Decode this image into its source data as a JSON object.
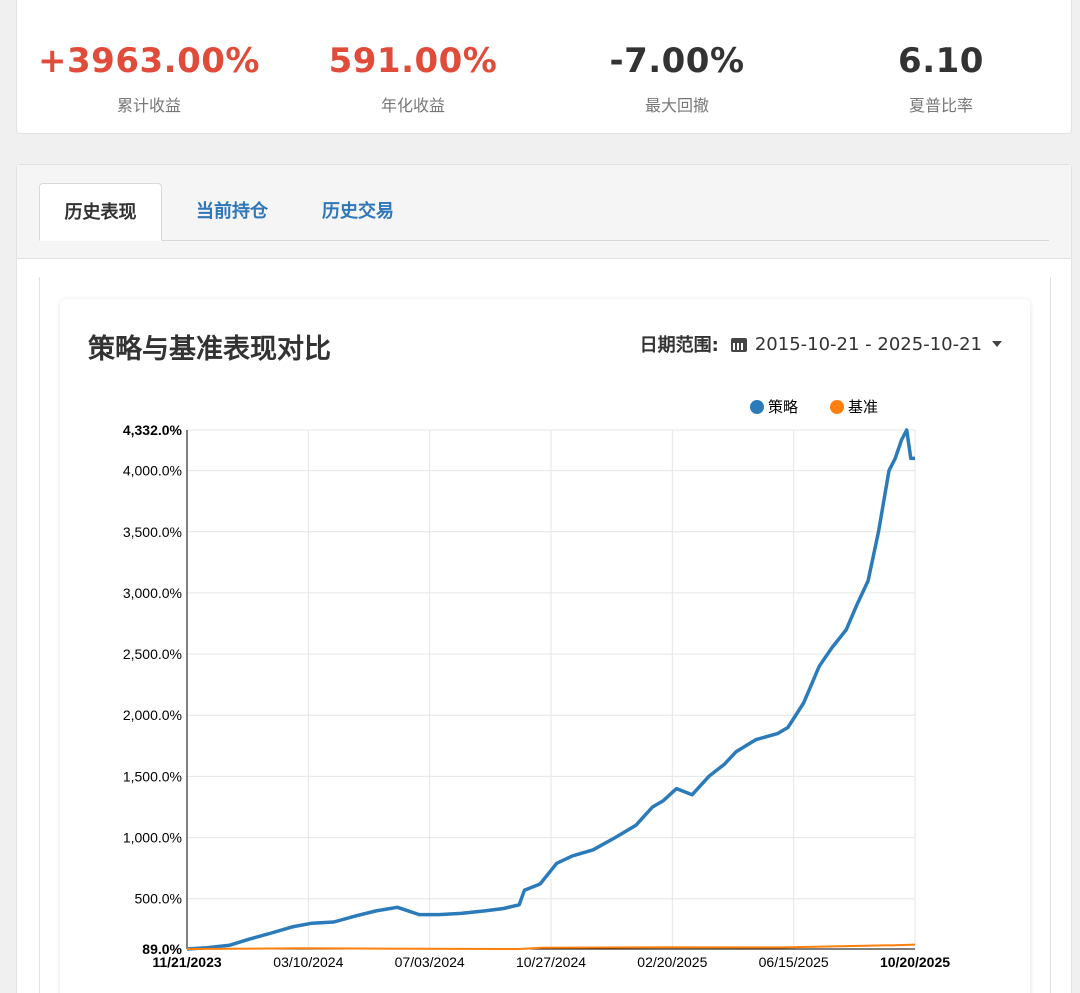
{
  "stats": [
    {
      "value": "+3963.00%",
      "label": "累计收益",
      "color": "#e04b3a"
    },
    {
      "value": "591.00%",
      "label": "年化收益",
      "color": "#e04b3a"
    },
    {
      "value": "-7.00%",
      "label": "最大回撤",
      "color": "#333333"
    },
    {
      "value": "6.10",
      "label": "夏普比率",
      "color": "#333333"
    }
  ],
  "tabs": [
    {
      "label": "历史表现",
      "active": true
    },
    {
      "label": "当前持仓",
      "active": false
    },
    {
      "label": "历史交易",
      "active": false
    }
  ],
  "chart_card": {
    "title": "策略与基准表现对比",
    "date_range_label": "日期范围:",
    "date_range_value": "2015-10-21 - 2025-10-21"
  },
  "chart_data": {
    "type": "line",
    "title": "",
    "xlabel": "",
    "ylabel": "",
    "ylim": [
      89,
      4332
    ],
    "y_ticks": [
      89,
      500,
      1000,
      1500,
      2000,
      2500,
      3000,
      3500,
      4000,
      4332
    ],
    "y_tick_labels": [
      "89.0%",
      "500.0%",
      "1,000.0%",
      "1,500.0%",
      "2,000.0%",
      "2,500.0%",
      "3,000.0%",
      "3,500.0%",
      "4,000.0%",
      "4,332.0%"
    ],
    "x_tick_labels": [
      "11/21/2023",
      "03/10/2024",
      "07/03/2024",
      "10/27/2024",
      "02/20/2025",
      "06/15/2025",
      "10/20/2025"
    ],
    "grid": true,
    "legend_position": "top-right",
    "colors": {
      "策略": "#2b7bba",
      "基准": "#ff7f0e"
    },
    "series": [
      {
        "name": "策略",
        "x": [
          "2023-11-21",
          "2023-12-10",
          "2024-01-01",
          "2024-01-20",
          "2024-02-10",
          "2024-03-01",
          "2024-03-20",
          "2024-04-10",
          "2024-05-01",
          "2024-05-20",
          "2024-06-10",
          "2024-07-01",
          "2024-07-20",
          "2024-08-10",
          "2024-09-01",
          "2024-09-20",
          "2024-10-05",
          "2024-10-10",
          "2024-10-25",
          "2024-11-10",
          "2024-11-25",
          "2024-12-15",
          "2025-01-05",
          "2025-01-25",
          "2025-02-10",
          "2025-02-20",
          "2025-03-05",
          "2025-03-20",
          "2025-04-05",
          "2025-04-20",
          "2025-05-01",
          "2025-05-20",
          "2025-06-10",
          "2025-06-20",
          "2025-07-05",
          "2025-07-20",
          "2025-08-01",
          "2025-08-15",
          "2025-08-25",
          "2025-09-05",
          "2025-09-15",
          "2025-09-25",
          "2025-10-01",
          "2025-10-07",
          "2025-10-12",
          "2025-10-16",
          "2025-10-20"
        ],
        "values": [
          89,
          100,
          120,
          170,
          220,
          270,
          300,
          310,
          360,
          400,
          430,
          370,
          370,
          380,
          400,
          420,
          450,
          570,
          620,
          790,
          850,
          900,
          1000,
          1100,
          1250,
          1300,
          1400,
          1350,
          1500,
          1600,
          1700,
          1800,
          1850,
          1900,
          2100,
          2400,
          2550,
          2700,
          2900,
          3100,
          3500,
          4000,
          4100,
          4250,
          4332,
          4100,
          4100
        ]
      },
      {
        "name": "基准",
        "x": [
          "2023-11-21",
          "2024-03-10",
          "2024-07-03",
          "2024-10-05",
          "2024-10-27",
          "2025-02-20",
          "2025-06-15",
          "2025-10-01",
          "2025-10-20"
        ],
        "values": [
          89,
          95,
          91,
          89,
          100,
          103,
          102,
          120,
          125
        ]
      }
    ]
  }
}
